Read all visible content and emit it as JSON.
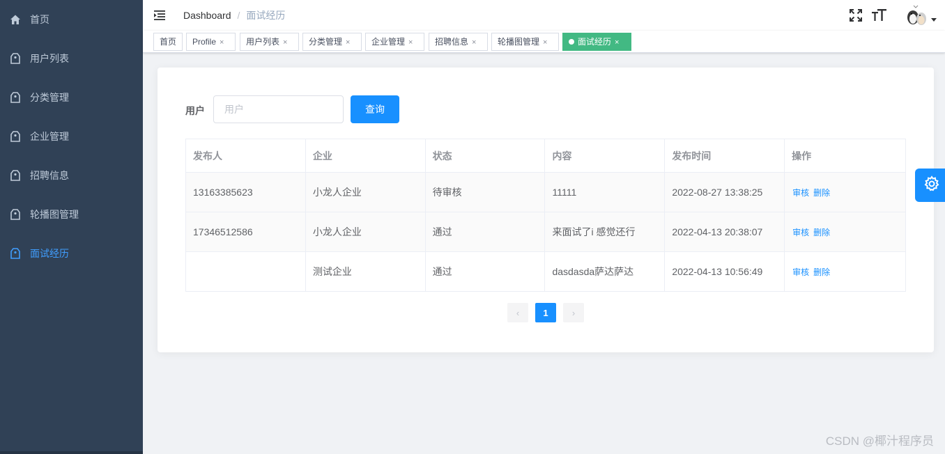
{
  "sidebar": {
    "items": [
      {
        "label": "首页",
        "icon": "home-icon",
        "active": false
      },
      {
        "label": "用户列表",
        "icon": "tag-icon",
        "active": false
      },
      {
        "label": "分类管理",
        "icon": "tag-icon",
        "active": false
      },
      {
        "label": "企业管理",
        "icon": "tag-icon",
        "active": false
      },
      {
        "label": "招聘信息",
        "icon": "tag-icon",
        "active": false
      },
      {
        "label": "轮播图管理",
        "icon": "tag-icon",
        "active": false
      },
      {
        "label": "面试经历",
        "icon": "tag-icon",
        "active": true
      }
    ]
  },
  "navbar": {
    "breadcrumb": {
      "root": "Dashboard",
      "separator": "/",
      "current": "面试经历"
    },
    "icons": [
      "hamburger-icon",
      "fullscreen-icon",
      "font-size-icon",
      "avatar",
      "caret-down-icon"
    ]
  },
  "tags": [
    {
      "label": "首页",
      "closable": false
    },
    {
      "label": "Profile",
      "closable": true
    },
    {
      "label": "用户列表",
      "closable": true
    },
    {
      "label": "分类管理",
      "closable": true
    },
    {
      "label": "企业管理",
      "closable": true
    },
    {
      "label": "招聘信息",
      "closable": true
    },
    {
      "label": "轮播图管理",
      "closable": true
    },
    {
      "label": "面试经历",
      "closable": true,
      "active": true
    }
  ],
  "tag_close_glyph": "×",
  "search": {
    "label": "用户",
    "value": "",
    "placeholder": "用户",
    "button_label": "查询"
  },
  "table": {
    "columns": [
      "发布人",
      "企业",
      "状态",
      "内容",
      "发布时间",
      "操作"
    ],
    "rows": [
      {
        "publisher": "13163385623",
        "company": "小龙人企业",
        "status": "待审核",
        "content": "11111",
        "time": "2022-08-27 13:38:25",
        "actions": [
          "审核",
          "删除"
        ]
      },
      {
        "publisher": "17346512586",
        "company": "小龙人企业",
        "status": "通过",
        "content": "来面试了i 感觉还行",
        "time": "2022-04-13 20:38:07",
        "actions": [
          "审核",
          "删除"
        ]
      },
      {
        "publisher": "",
        "company": "测试企业",
        "status": "通过",
        "content": "dasdasda萨达萨达",
        "time": "2022-04-13 10:56:49",
        "actions": [
          "审核",
          "删除"
        ]
      }
    ]
  },
  "pagination": {
    "current": "1",
    "prev_glyph": "‹",
    "next_glyph": "›"
  },
  "watermark": "CSDN @椰汁程序员",
  "colors": {
    "sidebar_bg": "#304156",
    "primary": "#1890ff",
    "tag_active": "#42b983",
    "menu_active": "#409eff"
  }
}
